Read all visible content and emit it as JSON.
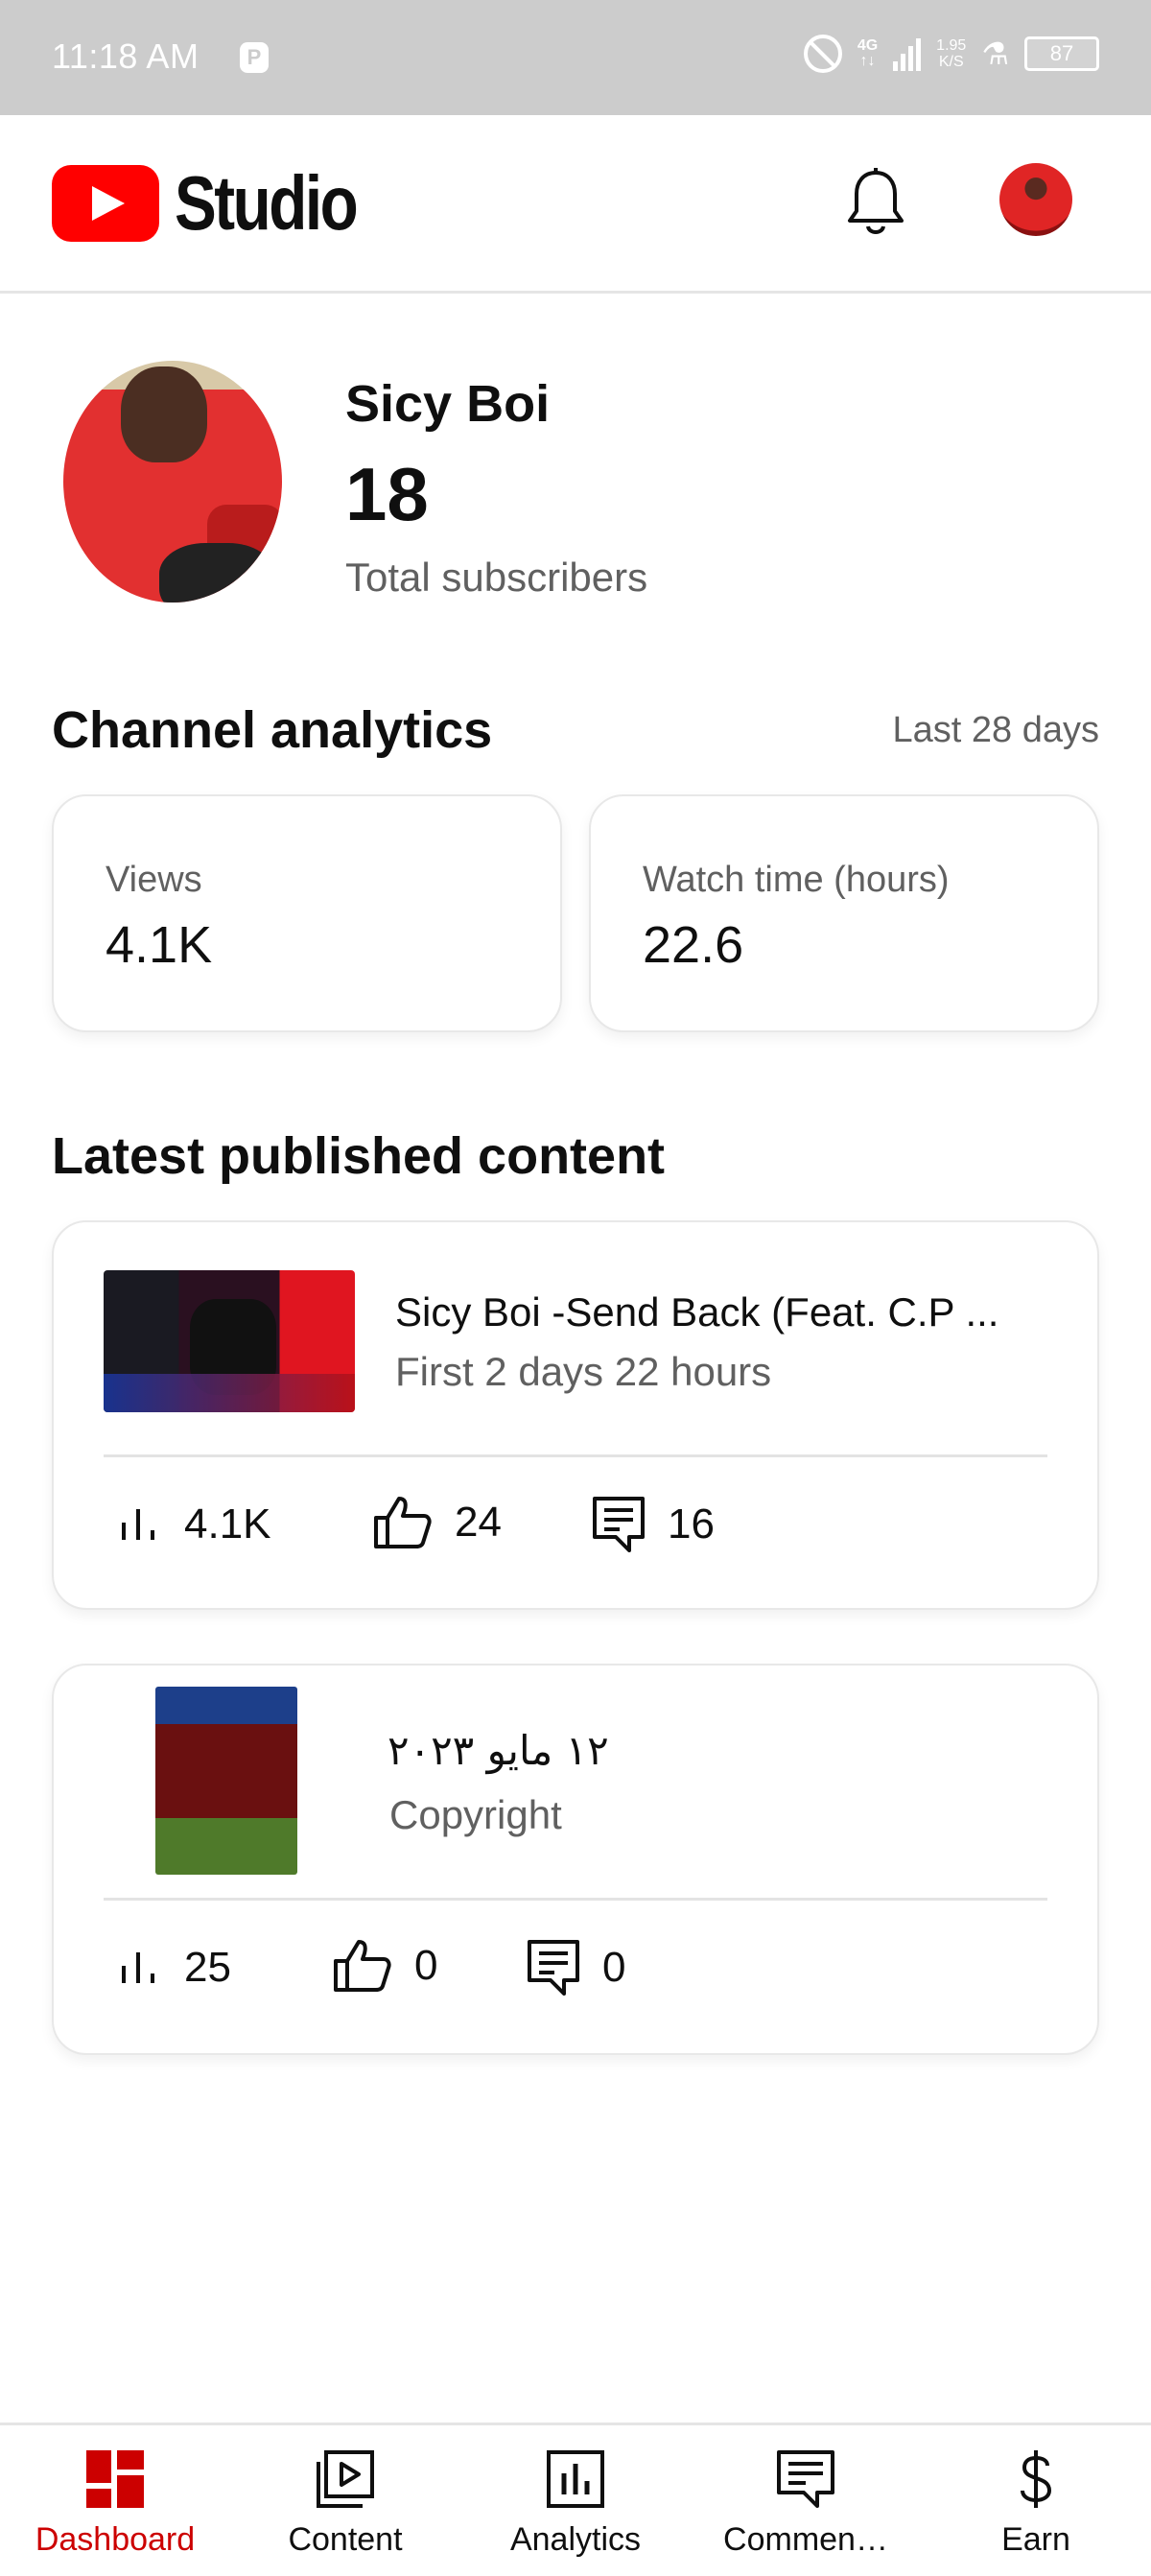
{
  "status_bar": {
    "time": "11:18 AM",
    "notification_badge": "P",
    "network_type": "4G",
    "network_sub": "↑↓",
    "speed_value": "1.95",
    "speed_unit": "K/S",
    "battery": "87"
  },
  "app_bar": {
    "logo_text": "Studio",
    "brand_color": "#ff0000"
  },
  "channel": {
    "name": "Sicy Boi",
    "subscribers": "18",
    "subscribers_label": "Total subscribers"
  },
  "analytics": {
    "title": "Channel analytics",
    "period": "Last 28 days",
    "metrics": [
      {
        "label": "Views",
        "value": "4.1K"
      },
      {
        "label": "Watch time (hours)",
        "value": "22.6"
      }
    ]
  },
  "latest": {
    "title": "Latest published content",
    "items": [
      {
        "title": "Sicy Boi -Send Back (Feat. C.P ...",
        "subtitle": "First 2 days 22 hours",
        "views": "4.1K",
        "likes": "24",
        "comments": "16"
      },
      {
        "title": "١٢ مايو ٢٠٢٣",
        "subtitle": "Copyright",
        "views": "25",
        "likes": "0",
        "comments": "0"
      }
    ]
  },
  "bottom_nav": {
    "active_color": "#cc0000",
    "items": [
      {
        "label": "Dashboard",
        "icon": "dashboard-icon",
        "active": true
      },
      {
        "label": "Content",
        "icon": "content-icon",
        "active": false
      },
      {
        "label": "Analytics",
        "icon": "analytics-icon",
        "active": false
      },
      {
        "label": "Commen…",
        "icon": "comments-icon",
        "active": false
      },
      {
        "label": "Earn",
        "icon": "dollar-icon",
        "active": false
      }
    ]
  }
}
